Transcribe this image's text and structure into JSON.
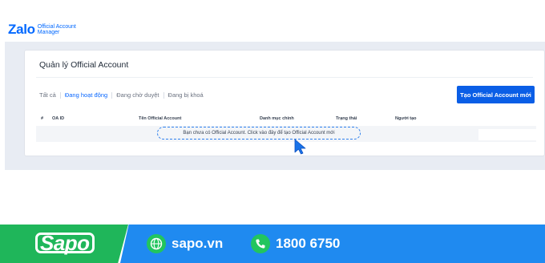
{
  "logo": {
    "main": "Zalo",
    "line1": "Official Account",
    "line2": "Manager"
  },
  "card": {
    "title": "Quản lý Official Account"
  },
  "tabs": [
    {
      "label": "Tất cả",
      "active": false
    },
    {
      "label": "Đang hoạt động",
      "active": true
    },
    {
      "label": "Đang chờ duyệt",
      "active": false
    },
    {
      "label": "Đang bị khoá",
      "active": false
    }
  ],
  "create_button": "Tạo Official Account mới",
  "table": {
    "headers": [
      "#",
      "OA ID",
      "Tên Official Account",
      "Danh mục chính",
      "Trạng thái",
      "Người tạo"
    ],
    "empty_message": "Bạn chưa có Official Account. Click vào đây để tạo Official Account mới"
  },
  "banner": {
    "brand": "Sapo",
    "website": "sapo.vn",
    "phone": "1800 6750",
    "colors": {
      "green": "#1fb65a",
      "blue": "#1f8af0"
    }
  },
  "icons": [
    "cursor-arrow-icon",
    "globe-icon",
    "phone-icon"
  ]
}
